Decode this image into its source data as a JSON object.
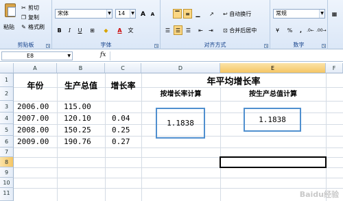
{
  "ribbon": {
    "clipboard": {
      "paste": "粘贴",
      "cut": "剪切",
      "copy": "复制",
      "format_painter": "格式刷",
      "label": "剪贴板"
    },
    "font": {
      "name": "宋体",
      "size": "14",
      "grow": "A",
      "shrink": "A",
      "bold": "B",
      "italic": "I",
      "underline": "U",
      "font_color": "A",
      "label": "字体"
    },
    "alignment": {
      "wrap_text": "自动换行",
      "merge_center": "合并后居中",
      "label": "对齐方式"
    },
    "number": {
      "format": "常规",
      "percent": "%",
      "comma": ",",
      "label": "数字"
    }
  },
  "formula_bar": {
    "cell_ref": "E8",
    "fx": "fx",
    "formula": ""
  },
  "columns": [
    "A",
    "B",
    "C",
    "D",
    "E",
    "F"
  ],
  "rows": [
    "1",
    "2",
    "3",
    "4",
    "5",
    "6",
    "7",
    "8",
    "9",
    "10",
    "11"
  ],
  "sheet": {
    "a_header": "年份",
    "b_header": "生产总值",
    "c_header": "增长率",
    "de_title": "年平均增长率",
    "d_sub": "按增长率计算",
    "e_sub": "按生产总值计算",
    "data": [
      {
        "year": "2006.00",
        "gdp": "115.00",
        "rate": ""
      },
      {
        "year": "2007.00",
        "gdp": "120.10",
        "rate": "0.04"
      },
      {
        "year": "2008.00",
        "gdp": "150.25",
        "rate": "0.25"
      },
      {
        "year": "2009.00",
        "gdp": "190.76",
        "rate": "0.27"
      }
    ],
    "d_result": "1.1838",
    "e_result": "1.1838"
  },
  "watermark": "Baidu经验",
  "colors": {
    "result_border": "#4f8fcf",
    "active_header": "#f5c665"
  }
}
